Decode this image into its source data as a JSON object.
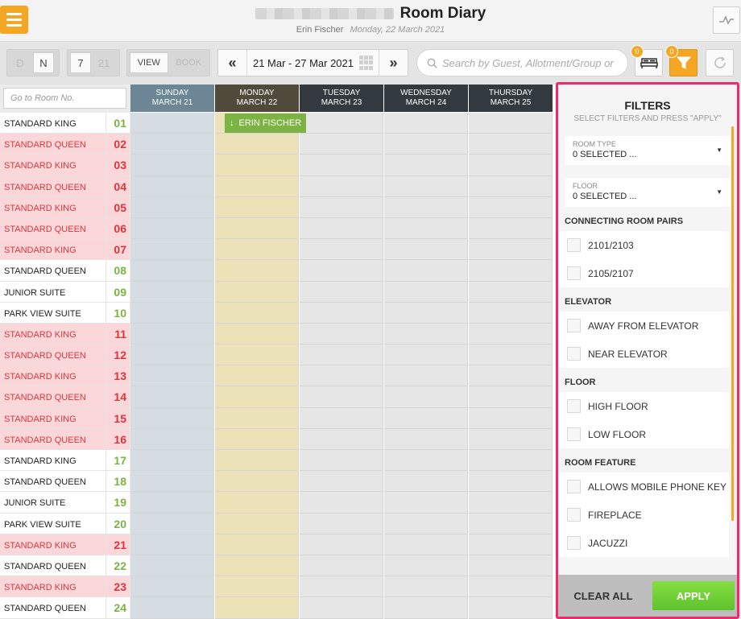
{
  "header": {
    "title": "Room Diary",
    "user": "Erin Fischer",
    "date": "Monday, 22 March 2021"
  },
  "toolbar": {
    "view_toggle": {
      "d": "D",
      "n": "N"
    },
    "days_toggle": {
      "seven": "7",
      "twentyone": "21"
    },
    "mode_toggle": {
      "view": "VIEW",
      "book": "BOOK"
    },
    "date_range": "21 Mar - 27 Mar 2021",
    "search_placeholder": "Search by Guest, Allotment/Group or",
    "rooms_badge": "0",
    "filter_badge": "0"
  },
  "room_search_placeholder": "Go to Room No.",
  "days": [
    {
      "day": "SUNDAY",
      "date": "MARCH 21",
      "head_color": "#6c8696",
      "col_color": "#d5dde3"
    },
    {
      "day": "MONDAY",
      "date": "MARCH 22",
      "head_color": "#4f4a3a",
      "col_color": "#ece2b8"
    },
    {
      "day": "TUESDAY",
      "date": "MARCH 23",
      "head_color": "#333a3f",
      "col_color": "#e6e6e6"
    },
    {
      "day": "WEDNESDAY",
      "date": "MARCH 24",
      "head_color": "#333a3f",
      "col_color": "#e6e6e6"
    },
    {
      "day": "THURSDAY",
      "date": "MARCH 25",
      "head_color": "#333a3f",
      "col_color": "#e6e6e6"
    }
  ],
  "booking": {
    "guest": "ERIN FISCHER"
  },
  "rooms": [
    {
      "name": "STANDARD KING",
      "number": "01",
      "dirty": false
    },
    {
      "name": "STANDARD QUEEN",
      "number": "02",
      "dirty": true
    },
    {
      "name": "STANDARD KING",
      "number": "03",
      "dirty": true
    },
    {
      "name": "STANDARD QUEEN",
      "number": "04",
      "dirty": true
    },
    {
      "name": "STANDARD KING",
      "number": "05",
      "dirty": true
    },
    {
      "name": "STANDARD QUEEN",
      "number": "06",
      "dirty": true
    },
    {
      "name": "STANDARD KING",
      "number": "07",
      "dirty": true
    },
    {
      "name": "STANDARD QUEEN",
      "number": "08",
      "dirty": false
    },
    {
      "name": "JUNIOR SUITE",
      "number": "09",
      "dirty": false
    },
    {
      "name": "PARK VIEW SUITE",
      "number": "10",
      "dirty": false
    },
    {
      "name": "STANDARD KING",
      "number": "11",
      "dirty": true
    },
    {
      "name": "STANDARD QUEEN",
      "number": "12",
      "dirty": true
    },
    {
      "name": "STANDARD KING",
      "number": "13",
      "dirty": true
    },
    {
      "name": "STANDARD QUEEN",
      "number": "14",
      "dirty": true
    },
    {
      "name": "STANDARD KING",
      "number": "15",
      "dirty": true
    },
    {
      "name": "STANDARD QUEEN",
      "number": "16",
      "dirty": true
    },
    {
      "name": "STANDARD KING",
      "number": "17",
      "dirty": false
    },
    {
      "name": "STANDARD QUEEN",
      "number": "18",
      "dirty": false
    },
    {
      "name": "JUNIOR SUITE",
      "number": "19",
      "dirty": false
    },
    {
      "name": "PARK VIEW SUITE",
      "number": "20",
      "dirty": false
    },
    {
      "name": "STANDARD KING",
      "number": "21",
      "dirty": true
    },
    {
      "name": "STANDARD QUEEN",
      "number": "22",
      "dirty": false
    },
    {
      "name": "STANDARD KING",
      "number": "23",
      "dirty": true
    },
    {
      "name": "STANDARD QUEEN",
      "number": "24",
      "dirty": false
    }
  ],
  "filters": {
    "title": "FILTERS",
    "subtitle": "SELECT FILTERS AND PRESS \"APPLY\"",
    "room_type": {
      "label": "ROOM TYPE",
      "value": "0 SELECTED ..."
    },
    "floor_dd": {
      "label": "FLOOR",
      "value": "0 SELECTED ..."
    },
    "sections": [
      {
        "title": "CONNECTING ROOM PAIRS",
        "items": [
          "2101/2103",
          "2105/2107"
        ]
      },
      {
        "title": "ELEVATOR",
        "items": [
          "AWAY FROM ELEVATOR",
          "NEAR ELEVATOR"
        ]
      },
      {
        "title": "FLOOR",
        "items": [
          "HIGH FLOOR",
          "LOW FLOOR"
        ]
      },
      {
        "title": "ROOM FEATURE",
        "items": [
          "ALLOWS MOBILE PHONE KEY",
          "FIREPLACE",
          "JACUZZI"
        ]
      }
    ],
    "clear_label": "CLEAR ALL",
    "apply_label": "APPLY"
  }
}
